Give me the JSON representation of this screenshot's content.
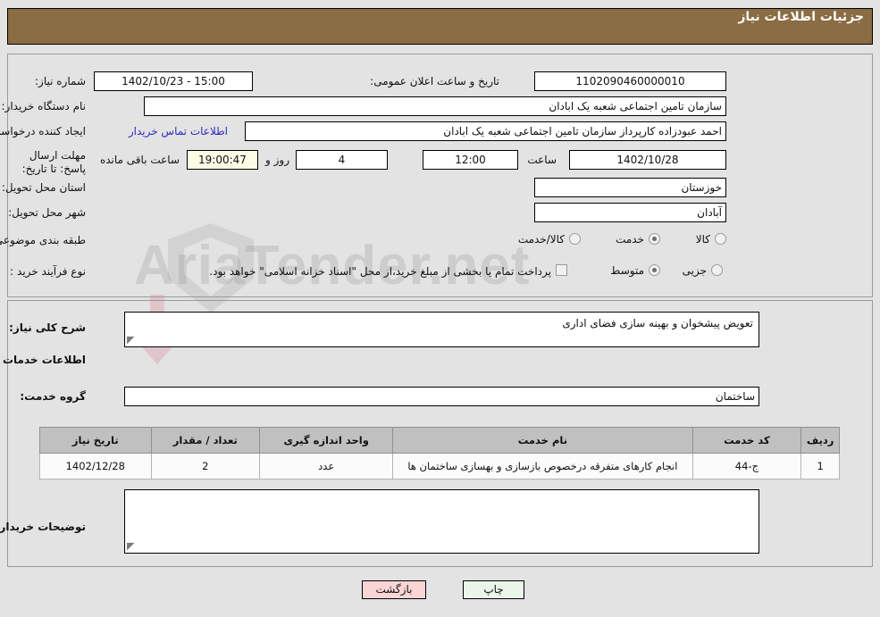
{
  "header": {
    "title": "جزئیات اطلاعات نیاز"
  },
  "watermark": {
    "text": "AriaTender.net"
  },
  "form": {
    "need_number_label": "شماره نیاز:",
    "need_number_value": "1102090460000010",
    "public_announce_label": "تاریخ و ساعت اعلان عمومی:",
    "public_announce_value": "15:00 - 1402/10/23",
    "buyer_org_label": "نام دستگاه خریدار:",
    "buyer_org_value": "سازمان تامین اجتماعی شعبه یک ابادان",
    "creator_label": "ایجاد کننده درخواست:",
    "creator_value": "احمد عبودزاده کارپرداز سازمان تامین اجتماعی شعبه یک ابادان",
    "contact_link": "اطلاعات تماس خریدار",
    "deadline_label": "مهلت ارسال پاسخ: تا تاریخ:",
    "deadline_date": "1402/10/28",
    "hour_label": "ساعت",
    "hour_value": "12:00",
    "days_value": "4",
    "days_suffix": "روز و",
    "countdown_value": "19:00:47",
    "countdown_suffix": "ساعت باقی مانده",
    "province_label": "استان محل تحویل:",
    "province_value": "خوزستان",
    "city_label": "شهر محل تحویل:",
    "city_value": "آبادان",
    "category_label": "طبقه بندی موضوعی:",
    "category_options": [
      {
        "label": "کالا",
        "selected": false
      },
      {
        "label": "خدمت",
        "selected": true
      },
      {
        "label": "کالا/خدمت",
        "selected": false
      }
    ],
    "process_label": "نوع فرآیند خرید :",
    "process_options": [
      {
        "label": "جزیی",
        "selected": false
      },
      {
        "label": "متوسط",
        "selected": true
      }
    ],
    "treasury_note": "پرداخت تمام یا بخشی از مبلغ خرید،از محل \"اسناد خزانه اسلامی\" خواهد بود."
  },
  "detail": {
    "general_desc_label": "شرح کلی نیاز:",
    "general_desc_value": "تعویض پیشخوان و بهینه سازی فضای اداری",
    "services_info_heading": "اطلاعات خدمات مورد نیاز",
    "service_group_label": "گروه خدمت:",
    "service_group_value": "ساختمان",
    "buyer_notes_label": "توضیحات خریدار;",
    "buyer_notes_value": ""
  },
  "table": {
    "columns": [
      "ردیف",
      "کد خدمت",
      "نام خدمت",
      "واحد اندازه گیری",
      "تعداد / مقدار",
      "تاریخ نیاز"
    ],
    "rows": [
      {
        "row": "1",
        "code": "ج-44",
        "name": "انجام کارهای متفرقه درخصوص بازسازی و بهسازی ساختمان ها",
        "unit": "عدد",
        "qty": "2",
        "date": "1402/12/28"
      }
    ]
  },
  "footer": {
    "print_label": "چاپ",
    "back_label": "بازگشت"
  },
  "colors": {
    "header_bg": "#8b6d43",
    "link": "#2b2bc8",
    "countdown_bg": "#fbfbe6",
    "print_bg": "#eaf6ea",
    "back_bg": "#fbd5d5"
  }
}
